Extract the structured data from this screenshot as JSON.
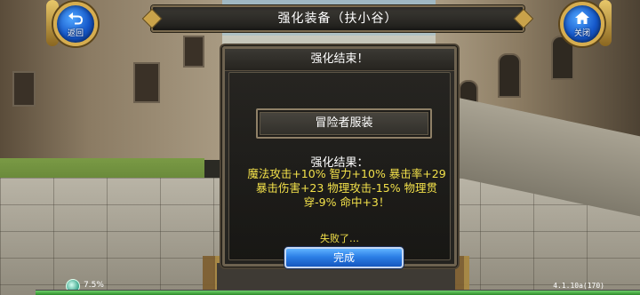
{
  "header": {
    "title": "强化装备（扶小谷）",
    "back_label": "返回",
    "close_label": "关闭"
  },
  "dialog": {
    "title": "强化结束！",
    "item_name": "冒险者服装",
    "result_heading": "强化结果：",
    "result_lines": [
      "魔法攻击+10% 智力+10% 暴击率+29",
      "暴击伤害+23 物理攻击-15% 物理贯",
      "穿-9% 命中+3！"
    ],
    "fail_text": "失败了…",
    "done_label": "完成"
  },
  "status": {
    "battery_percent": "7.5%",
    "version": "4.1.10a(170)",
    "progress_fraction": 1.0
  },
  "colors": {
    "accent_blue": "#2c7fe6",
    "result_yellow": "#f2e04a",
    "frame_gold": "#d6ad4f"
  }
}
